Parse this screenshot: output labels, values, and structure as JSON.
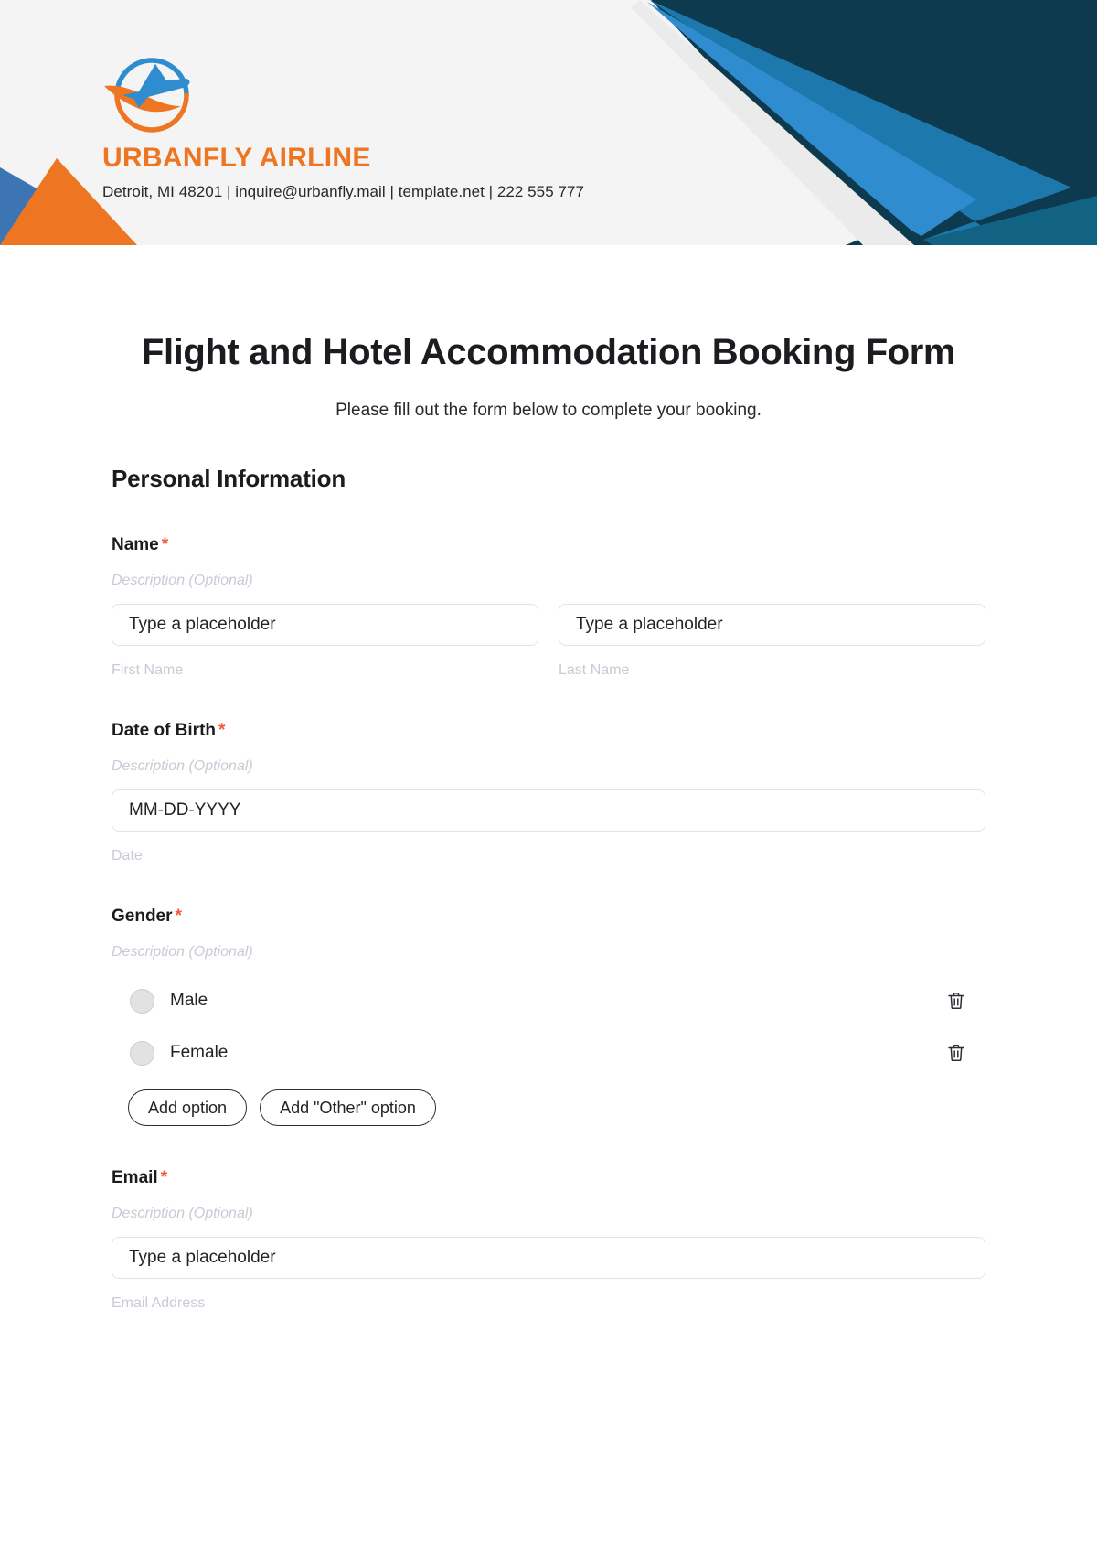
{
  "header": {
    "brand_name": "URBANFLY AIRLINE",
    "contact_line": "Detroit, MI 48201 | inquire@urbanfly.mail | template.net | 222 555 777",
    "logo_icon": "airplane-circle-logo-icon",
    "colors": {
      "orange": "#ee7623",
      "blue": "#2e8ccf",
      "blue_mid": "#1d78ad",
      "blue_dark": "#0e3a4f",
      "blue_flat": "#3c74b4",
      "background": "#f4f4f4"
    }
  },
  "form": {
    "title": "Flight and Hotel Accommodation Booking Form",
    "subtitle": "Please fill out the form below to complete your booking.",
    "section_title": "Personal Information",
    "description_placeholder": "Description (Optional)",
    "required_marker": "*",
    "fields": {
      "name": {
        "label": "Name",
        "description": "Description (Optional)",
        "first": {
          "value": "Type a placeholder",
          "sub_label": "First Name"
        },
        "last": {
          "value": "Type a placeholder",
          "sub_label": "Last Name"
        }
      },
      "dob": {
        "label": "Date of Birth",
        "description": "Description (Optional)",
        "value": "MM-DD-YYYY",
        "sub_label": "Date"
      },
      "gender": {
        "label": "Gender",
        "description": "Description (Optional)",
        "options": [
          {
            "label": "Male",
            "delete_icon": "trash-icon"
          },
          {
            "label": "Female",
            "delete_icon": "trash-icon"
          }
        ],
        "add_option_label": "Add option",
        "add_other_option_label": "Add \"Other\" option"
      },
      "email": {
        "label": "Email",
        "description": "Description (Optional)",
        "value": "Type a placeholder",
        "sub_label": "Email Address"
      }
    }
  }
}
